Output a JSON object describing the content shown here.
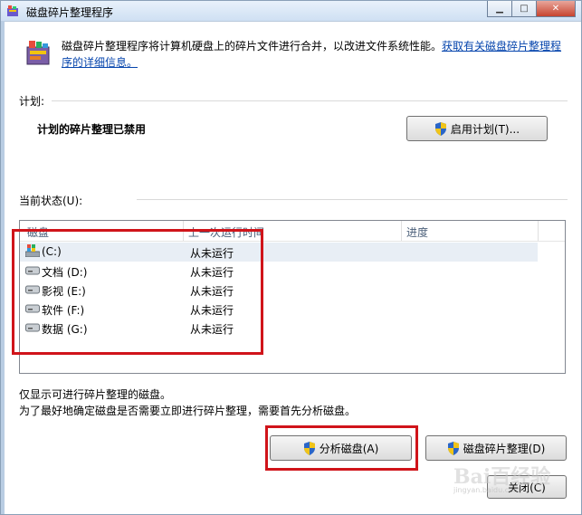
{
  "window": {
    "title": "磁盘碎片整理程序",
    "min_glyph": "▁",
    "max_glyph": "□",
    "close_glyph": "✕"
  },
  "intro": {
    "text": "磁盘碎片整理程序将计算机硬盘上的碎片文件进行合并，以改进文件系统性能。",
    "link": "获取有关磁盘碎片整理程序的详细信息。"
  },
  "schedule": {
    "label": "计划:",
    "status": "计划的碎片整理已禁用",
    "button_label": "启用计划(T)..."
  },
  "current_status": {
    "label": "当前状态(U):",
    "columns": [
      "磁盘",
      "上一次运行时间",
      "进度"
    ],
    "disks": [
      {
        "name": "(C:)",
        "last_run": "从未运行",
        "icon": "system-drive-icon"
      },
      {
        "name": "文档 (D:)",
        "last_run": "从未运行",
        "icon": "drive-icon"
      },
      {
        "name": "影视 (E:)",
        "last_run": "从未运行",
        "icon": "drive-icon"
      },
      {
        "name": "软件 (F:)",
        "last_run": "从未运行",
        "icon": "drive-icon"
      },
      {
        "name": "数据 (G:)",
        "last_run": "从未运行",
        "icon": "drive-icon"
      }
    ]
  },
  "notes": {
    "line1": "仅显示可进行碎片整理的磁盘。",
    "line2": "为了最好地确定磁盘是否需要立即进行碎片整理，需要首先分析磁盘。"
  },
  "buttons": {
    "analyze": "分析磁盘(A)",
    "defrag": "磁盘碎片整理(D)",
    "close": "关闭(C)"
  },
  "watermark": {
    "text": "Bai百经验",
    "sub": "jingyan.baidu.com"
  },
  "colors": {
    "highlight_border": "#d0141a",
    "link": "#0645ad",
    "shield_blue": "#2a66c8",
    "shield_yellow": "#f0c419"
  }
}
